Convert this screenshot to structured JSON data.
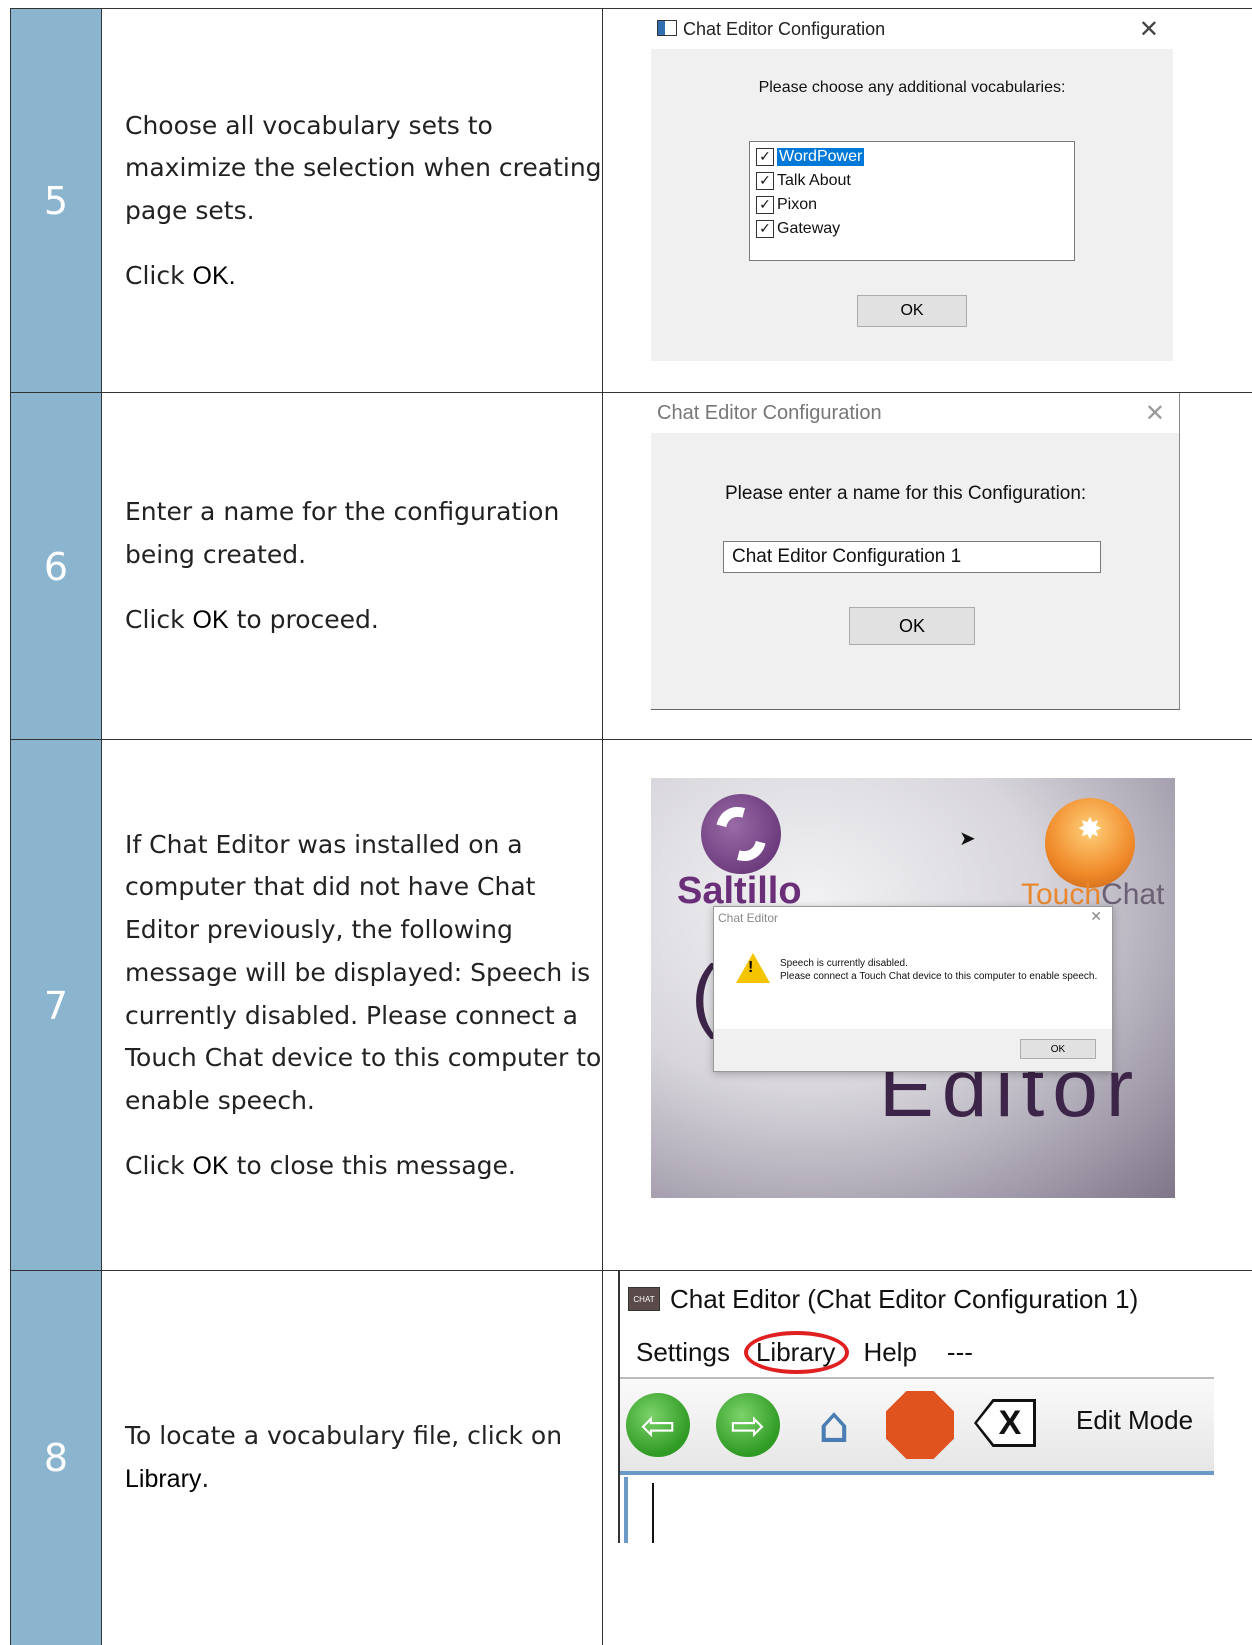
{
  "steps": [
    {
      "number": "5",
      "paragraphs": [
        {
          "text": "Choose all vocabulary sets to maximize the selection when creating page sets.",
          "bold": ""
        },
        {
          "pre": "Click ",
          "bold": "OK.",
          "post": ""
        }
      ],
      "dialog": {
        "title": "Chat Editor Configuration",
        "prompt": "Please choose any additional vocabularies:",
        "items": [
          "WordPower",
          "Talk About",
          "Pixon",
          "Gateway"
        ],
        "checked": [
          true,
          true,
          true,
          true
        ],
        "selected_index": 0,
        "ok_label": "OK"
      }
    },
    {
      "number": "6",
      "paragraphs": [
        {
          "text": "Enter a name for the configuration being created."
        },
        {
          "pre": "Click ",
          "bold": "OK",
          "post": " to proceed."
        }
      ],
      "dialog": {
        "title": "Chat Editor Configuration",
        "prompt": "Please enter a name for this Configuration:",
        "name_value": "Chat Editor Configuration 1",
        "ok_label": "OK"
      }
    },
    {
      "number": "7",
      "paragraphs": [
        {
          "text": "If Chat Editor was installed on a computer that did not have Chat Editor previously, the following message will be displayed: Speech is currently disabled. Please connect a Touch Chat device to this computer to enable speech."
        },
        {
          "pre": "Click ",
          "bold": "OK",
          "post": " to close this message."
        }
      ],
      "splash": {
        "brand": "Saltillo",
        "touch": "Touch",
        "chat": "Chat",
        "editor": "Editor",
        "alert_title": "Chat Editor",
        "alert_line1": "Speech is currently disabled.",
        "alert_line2": "Please connect a Touch Chat device to this computer to enable speech.",
        "ok_label": "OK"
      }
    },
    {
      "number": "8",
      "paragraphs": [
        {
          "pre": "To locate a vocabulary file, click on ",
          "bold": "Library",
          "post": "."
        }
      ],
      "app": {
        "icon_text": "CHAT",
        "title": "Chat Editor (Chat Editor Configuration 1)",
        "menu": [
          "Settings",
          "Library",
          "Help",
          "---"
        ],
        "edit_mode": "Edit Mode"
      }
    }
  ],
  "colors": {
    "number_column": "#8bb4cf",
    "highlight_circle": "#e02020",
    "selection_blue": "#0078d7"
  }
}
